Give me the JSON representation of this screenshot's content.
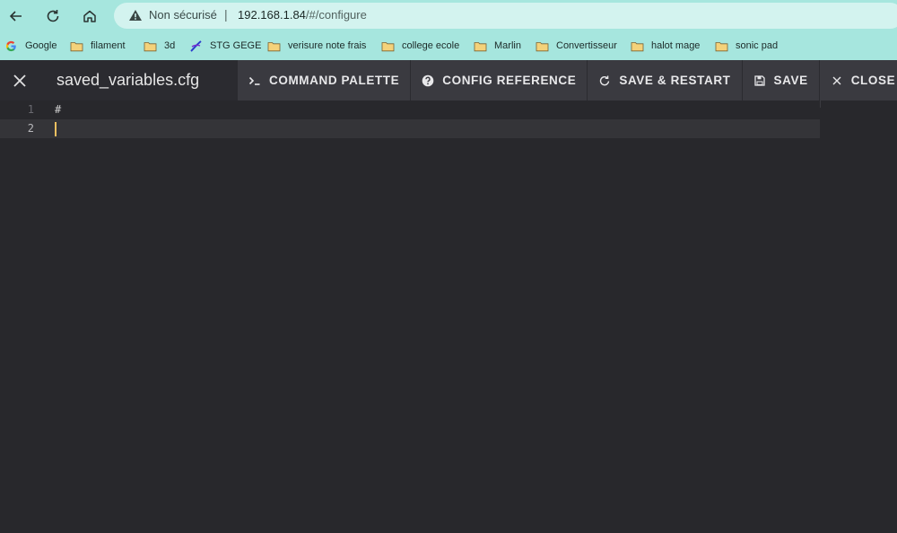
{
  "browser": {
    "url_warning": "Non sécurisé",
    "url_separator": "|",
    "url_host": "192.168.1.84",
    "url_path": "/#/configure",
    "accent_color": "#a6e6de"
  },
  "bookmarks": [
    {
      "label": "Google",
      "icon": "google-icon"
    },
    {
      "label": "filament",
      "icon": "folder-icon"
    },
    {
      "label": "3d",
      "icon": "folder-icon"
    },
    {
      "label": "STG GEGE",
      "icon": "stg-logo-icon"
    },
    {
      "label": "verisure note frais",
      "icon": "folder-icon"
    },
    {
      "label": "college ecole",
      "icon": "folder-icon"
    },
    {
      "label": "Marlin",
      "icon": "folder-icon"
    },
    {
      "label": "Convertisseur",
      "icon": "folder-icon"
    },
    {
      "label": "halot mage",
      "icon": "folder-icon"
    },
    {
      "label": "sonic pad",
      "icon": "folder-icon"
    }
  ],
  "editor_header": {
    "file_name": "saved_variables.cfg",
    "actions": [
      {
        "label": "COMMAND PALETTE",
        "icon": "console-icon"
      },
      {
        "label": "CONFIG REFERENCE",
        "icon": "help-circle-icon"
      },
      {
        "label": "SAVE & RESTART",
        "icon": "restart-icon"
      },
      {
        "label": "SAVE",
        "icon": "floppy-icon"
      },
      {
        "label": "CLOSE",
        "icon": "close-icon"
      }
    ]
  },
  "editor": {
    "lines": [
      {
        "number": "1",
        "text": "#"
      },
      {
        "number": "2",
        "text": ""
      }
    ],
    "current_line": 2,
    "cursor_color": "#f0c060"
  }
}
